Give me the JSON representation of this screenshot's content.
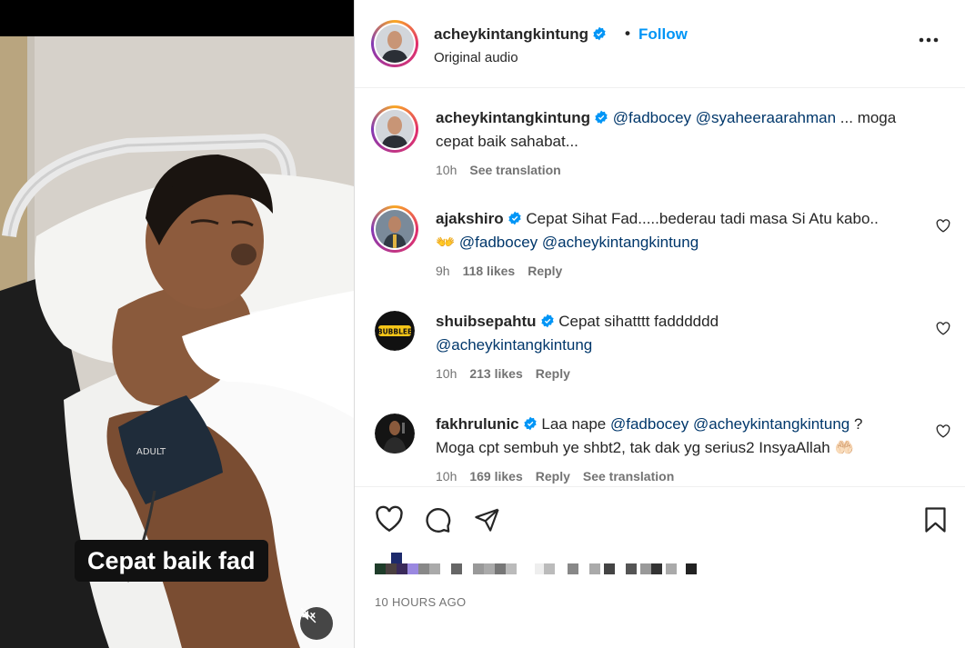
{
  "video": {
    "caption": "Cepat baik fad",
    "mute_icon": "speaker-muted-icon"
  },
  "post": {
    "author": "acheykintangkintung",
    "separator": "•",
    "follow_label": "Follow",
    "audio": "Original audio",
    "more_icon": "more-horizontal-icon",
    "verified_color": "#0095f6"
  },
  "comments": [
    {
      "user": "acheykintangkintung",
      "mentions": [
        "@fadbocey",
        "@syaheeraarahman"
      ],
      "text": "... moga cepat baik sahabat...",
      "time": "10h",
      "likes": "",
      "reply": "",
      "translate": "See translation"
    },
    {
      "user": "ajakshiro",
      "text": "Cepat Sihat Fad.....bederau tadi masa Si Atu kabo..",
      "emoji": "👐",
      "mentions": [
        "@fadbocey",
        "@acheykintangkintung"
      ],
      "time": "9h",
      "likes": "118 likes",
      "reply": "Reply"
    },
    {
      "user": "shuibsepahtu",
      "text": "Cepat sihatttt fadddddd",
      "mentions": [
        "@acheykintangkintung"
      ],
      "time": "10h",
      "likes": "213 likes",
      "reply": "Reply",
      "avatar_text": "BUBBLEE"
    },
    {
      "user": "fakhrulunic",
      "text_a": "Laa nape",
      "mentions": [
        "@fadbocey",
        "@acheykintangkintung"
      ],
      "text_b": "?",
      "text_c": "Moga cpt sembuh ye shbt2, tak dak yg serius2 InsyaAllah",
      "emoji": "🤲🏻",
      "time": "10h",
      "likes": "169 likes",
      "reply": "Reply",
      "translate": "See translation"
    }
  ],
  "actions": {
    "like_icon": "heart-icon",
    "comment_icon": "comment-icon",
    "share_icon": "send-icon",
    "save_icon": "bookmark-icon"
  },
  "timestamp": "10 HOURS AGO",
  "colors": {
    "link": "#0095f6",
    "mention": "#00376b",
    "muted": "#737373"
  }
}
